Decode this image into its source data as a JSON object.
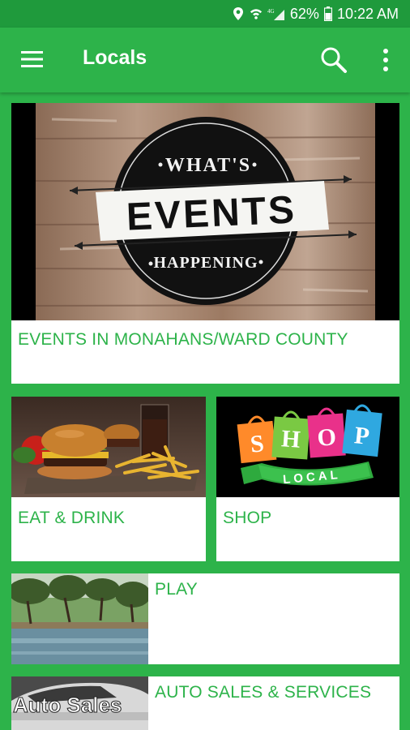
{
  "status_bar": {
    "battery": "62%",
    "time": "10:22 AM"
  },
  "toolbar": {
    "title": "Locals",
    "menu_icon": "hamburger-icon",
    "search_icon": "search-icon",
    "overflow_icon": "more-vert-icon"
  },
  "cards": {
    "events": {
      "label": "EVENTS IN MONAHANS/WARD COUNTY",
      "image_text": {
        "top": "WHAT'S",
        "main": "EVENTS",
        "bottom": "HAPPENING"
      }
    },
    "eat": {
      "label": "EAT & DRINK"
    },
    "shop": {
      "label": "SHOP",
      "image_text": {
        "letters": [
          "S",
          "H",
          "O",
          "P"
        ],
        "banner": "LOCAL"
      }
    },
    "play": {
      "label": "PLAY"
    },
    "auto": {
      "label": "AUTO SALES & SERVICES",
      "image_text": "Auto Sales"
    }
  },
  "colors": {
    "primary": "#2db34a",
    "status_bar": "#1f9a3c",
    "card_bg": "#ffffff",
    "label_text": "#2db34a"
  }
}
